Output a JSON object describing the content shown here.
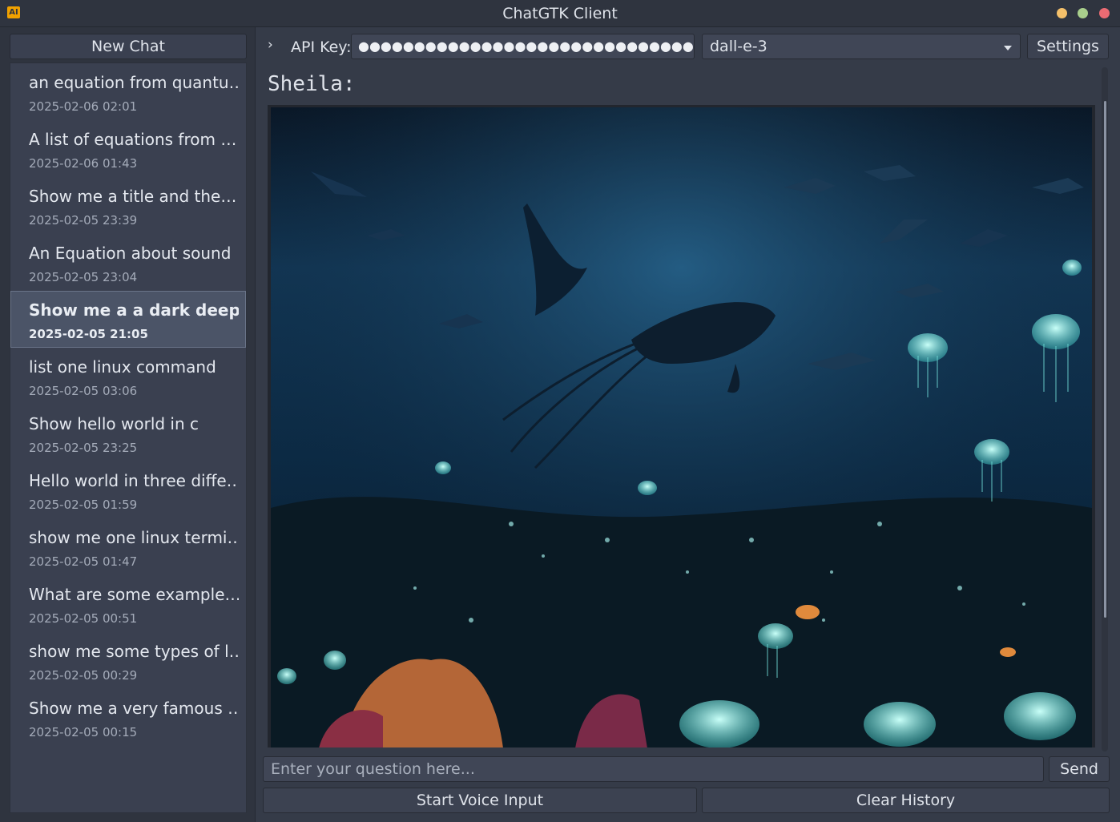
{
  "window": {
    "title": "ChatGTK Client",
    "app_icon_text": "AI"
  },
  "sidebar": {
    "new_chat_label": "New Chat",
    "items": [
      {
        "title": "an equation from quantu…",
        "date": "2025-02-06 02:01"
      },
      {
        "title": "A list of equations from …",
        "date": "2025-02-06 01:43"
      },
      {
        "title": "Show me a title and the…",
        "date": "2025-02-05 23:39"
      },
      {
        "title": "An Equation about sound",
        "date": "2025-02-05 23:04"
      },
      {
        "title": "Show me a a dark deep o…",
        "date": "2025-02-05 21:05"
      },
      {
        "title": "list one linux command",
        "date": "2025-02-05 03:06"
      },
      {
        "title": "Show hello world in c",
        "date": "2025-02-05 23:25"
      },
      {
        "title": "Hello world in three diffe…",
        "date": "2025-02-05 01:59"
      },
      {
        "title": "show me one linux termi…",
        "date": "2025-02-05 01:47"
      },
      {
        "title": "What are some example…",
        "date": "2025-02-05 00:51"
      },
      {
        "title": "show me some types of l…",
        "date": "2025-02-05 00:29"
      },
      {
        "title": "Show me a very famous …",
        "date": "2025-02-05 00:15"
      }
    ]
  },
  "toolbar": {
    "toggle_icon": "chevron-right-icon",
    "api_key_label": "API Key:",
    "api_key_value": "●●●●●●●●●●●●●●●●●●●●●●●●●●●●●●●●●●●●●●●●",
    "model": "dall-e-3",
    "settings_label": "Settings"
  },
  "conversation": {
    "speaker": "Sheila:"
  },
  "input": {
    "placeholder": "Enter your question here...",
    "send_label": "Send",
    "voice_label": "Start Voice Input",
    "clear_label": "Clear History"
  }
}
